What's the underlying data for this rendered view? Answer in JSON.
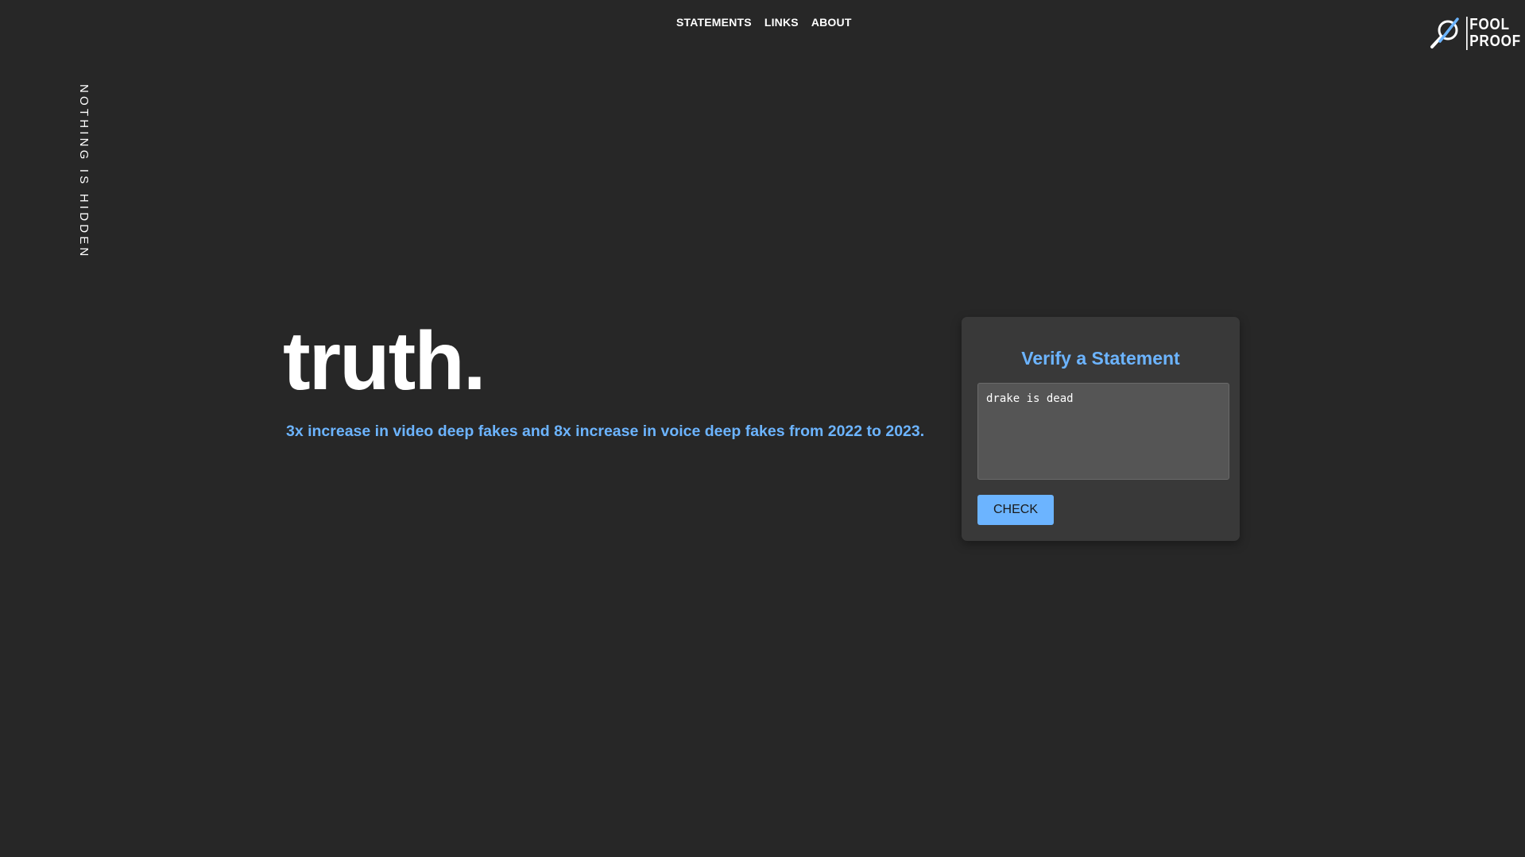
{
  "nav": {
    "items": [
      "STATEMENTS",
      "LINKS",
      "ABOUT"
    ]
  },
  "logo": {
    "line1": "FOOL",
    "line2": "PROOF",
    "icon": "magnifier-slash-icon"
  },
  "side_tag": "NOTHING IS HIDDEN",
  "hero": {
    "title": "truth.",
    "subtitle": "3x increase in video deep fakes and 8x increase in voice deep fakes from 2022 to 2023."
  },
  "verify_card": {
    "title": "Verify a Statement",
    "input_value": "drake is dead",
    "button_label": "CHECK"
  },
  "colors": {
    "background": "#272727",
    "card": "#393939",
    "accent": "#6cb4ff",
    "input": "#555555"
  }
}
